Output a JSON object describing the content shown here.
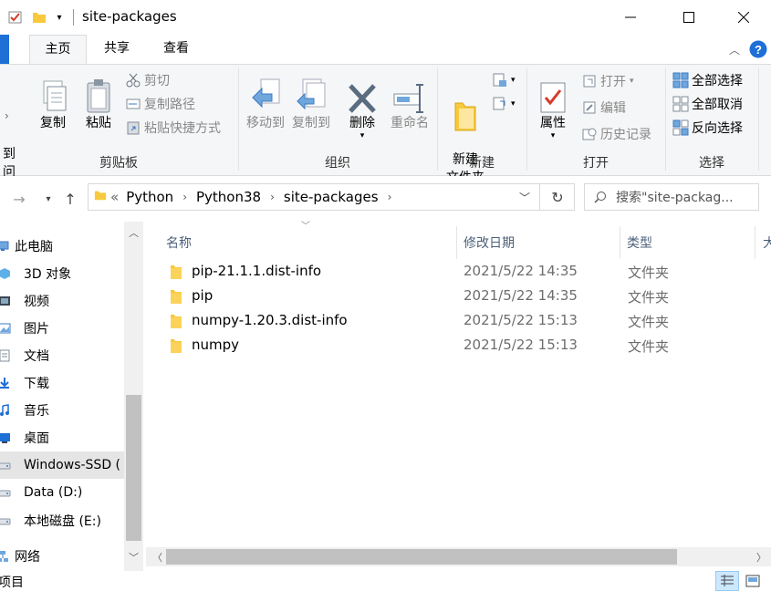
{
  "window": {
    "title": "site-packages"
  },
  "tabs": {
    "file": "",
    "home": "主页",
    "share": "共享",
    "view": "查看"
  },
  "ribbon": {
    "clipboard": {
      "label": "剪贴板",
      "pin_partial": "到\n问",
      "copy": "复制",
      "paste": "粘贴",
      "cut": "剪切",
      "copy_path": "复制路径",
      "paste_shortcut": "粘贴快捷方式"
    },
    "organize": {
      "label": "组织",
      "move_to": "移动到",
      "copy_to": "复制到",
      "delete": "删除",
      "rename": "重命名"
    },
    "new": {
      "label": "新建",
      "new_folder": "新建\n文件夹"
    },
    "open": {
      "label": "打开",
      "properties": "属性",
      "open": "打开",
      "edit": "编辑",
      "history": "历史记录"
    },
    "select": {
      "label": "选择",
      "select_all": "全部选择",
      "select_none": "全部取消",
      "invert": "反向选择"
    }
  },
  "address": {
    "prefix": "«",
    "crumbs": [
      "Python",
      "Python38",
      "site-packages"
    ],
    "search_placeholder": "搜索\"site-packag..."
  },
  "nav": {
    "items": [
      {
        "label": "此电脑",
        "icon": "pc-icon"
      },
      {
        "label": "3D 对象",
        "icon": "3d-objects-icon"
      },
      {
        "label": "视频",
        "icon": "video-icon"
      },
      {
        "label": "图片",
        "icon": "pictures-icon"
      },
      {
        "label": "文档",
        "icon": "documents-icon"
      },
      {
        "label": "下载",
        "icon": "downloads-icon"
      },
      {
        "label": "音乐",
        "icon": "music-icon"
      },
      {
        "label": "桌面",
        "icon": "desktop-icon"
      },
      {
        "label": "Windows-SSD (",
        "icon": "drive-icon"
      },
      {
        "label": "Data (D:)",
        "icon": "drive-icon"
      },
      {
        "label": "本地磁盘 (E:)",
        "icon": "drive-icon"
      },
      {
        "label": "网络",
        "icon": "network-icon"
      }
    ]
  },
  "columns": {
    "name": "名称",
    "date": "修改日期",
    "type": "类型",
    "size": "大"
  },
  "files": [
    {
      "name": "pip-21.1.1.dist-info",
      "date": "2021/5/22 14:35",
      "type": "文件夹"
    },
    {
      "name": "pip",
      "date": "2021/5/22 14:35",
      "type": "文件夹"
    },
    {
      "name": "numpy-1.20.3.dist-info",
      "date": "2021/5/22 15:13",
      "type": "文件夹"
    },
    {
      "name": "numpy",
      "date": "2021/5/22 15:13",
      "type": "文件夹"
    }
  ],
  "status": {
    "count": "项目"
  },
  "colors": {
    "accent": "#0078d7",
    "folder": "#f8c93c",
    "help": "#1e6fd6"
  }
}
